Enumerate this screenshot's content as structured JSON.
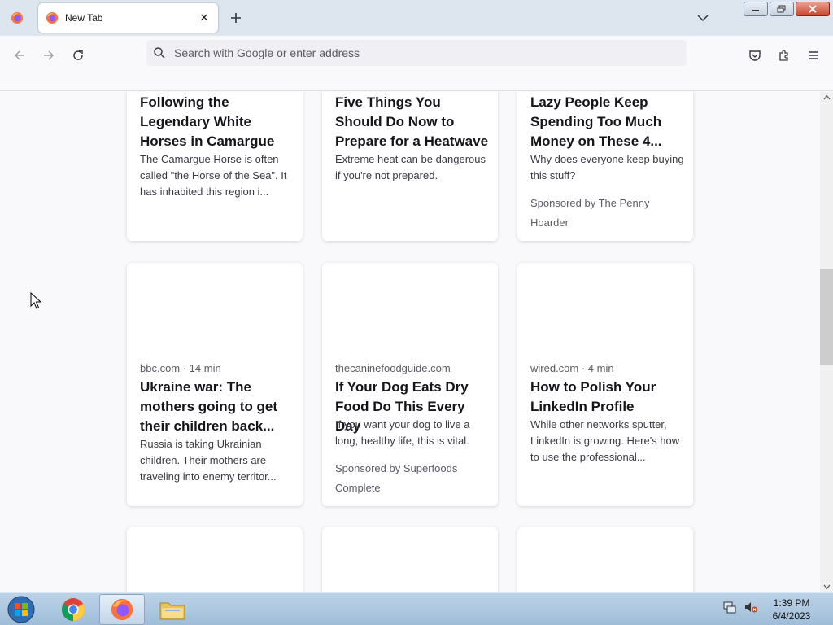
{
  "tabs": [
    {
      "title": "New Tab",
      "icon": "firefox-icon"
    }
  ],
  "urlbar": {
    "placeholder": "Search with Google or enter address"
  },
  "cards": [
    {
      "source": "",
      "title": "Following the Legendary White Horses in Camargue",
      "excerpt": "The Camargue Horse is often called \"the Horse of the Sea\". It has inhabited this region i...",
      "sponsor": ""
    },
    {
      "source": "",
      "title": "Five Things You Should Do Now to Prepare for a Heatwave",
      "excerpt": "Extreme heat can be dangerous if you're not prepared.",
      "sponsor": ""
    },
    {
      "source": "",
      "title": "Lazy People Keep Spending Too Much Money on These 4...",
      "excerpt": "Why does everyone keep buying this stuff?",
      "sponsor": "Sponsored by The Penny Hoarder"
    },
    {
      "source": "bbc.com · 14 min",
      "title": "Ukraine war: The mothers going to get their children back...",
      "excerpt": "Russia is taking Ukrainian children. Their mothers are traveling into enemy territor...",
      "sponsor": ""
    },
    {
      "source": "thecaninefoodguide.com",
      "title": "If Your Dog Eats Dry Food Do This Every Day",
      "excerpt": "If you want your dog to live a long, healthy life, this is vital.",
      "sponsor": "Sponsored by Superfoods Complete"
    },
    {
      "source": "wired.com · 4 min",
      "title": "How to Polish Your LinkedIn Profile",
      "excerpt": "While other networks sputter, LinkedIn is growing. Here's how to use the professional...",
      "sponsor": ""
    }
  ],
  "taskbar": {
    "items": [
      "windows-start-icon",
      "chrome-icon",
      "firefox-icon",
      "file-explorer-icon"
    ],
    "clock": {
      "time": "1:39 PM",
      "date": "6/4/2023"
    }
  },
  "colors": {
    "accent": "#0060df",
    "tabstrip": "#dde6ef",
    "text": "#15141a"
  }
}
